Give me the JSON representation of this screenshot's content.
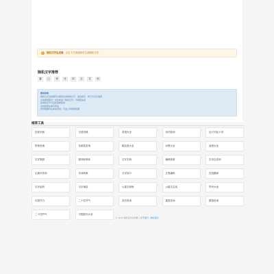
{
  "warning": {
    "title": "随机汉字生成器",
    "text": "点击下方按钮即可生成随机汉字"
  },
  "section": {
    "title": "随机汉字推荐",
    "chars": [
      "春",
      "山",
      "海",
      "月",
      "风",
      "云",
      "花",
      "雨"
    ]
  },
  "info": {
    "title": "使用说明",
    "lines": [
      "随机汉字生成器可以随机生成常用汉字，适合练字、学习与记忆使用",
      "点击按钮即可一次生成多个随机汉字，可重复生成",
      "生成的汉字可直接复制使用",
      "支持批量生成与导出",
      "所有数据均在本地完成，不会上传到服务器"
    ]
  },
  "tools": {
    "title": "推荐工具",
    "items": [
      "在线字典",
      "汉语词典",
      "成语大全",
      "诗词查询",
      "近义词反义词",
      "拼音查询",
      "百家姓查询",
      "歇后语大全",
      "对联大全",
      "谜语大全",
      "汉字笔顺",
      "繁体转简体",
      "汉字字典",
      "偏旁部首",
      "古诗文查询",
      "生僻字查询",
      "字体转换",
      "汉字拆分",
      "五笔编码",
      "在线翻译",
      "汉字结构",
      "汉字演变",
      "火星文转换",
      "火星文生成",
      "符号大全",
      "中国节日",
      "二十四节气",
      "农历查询",
      "星座查询",
      "属相查询",
      "二十四节气",
      "中国姓氏大全"
    ]
  },
  "footer": {
    "copyright": "© 2024 随机汉字生成器",
    "link1": "关于我们",
    "sep": " | ",
    "link2": "联系我们"
  }
}
